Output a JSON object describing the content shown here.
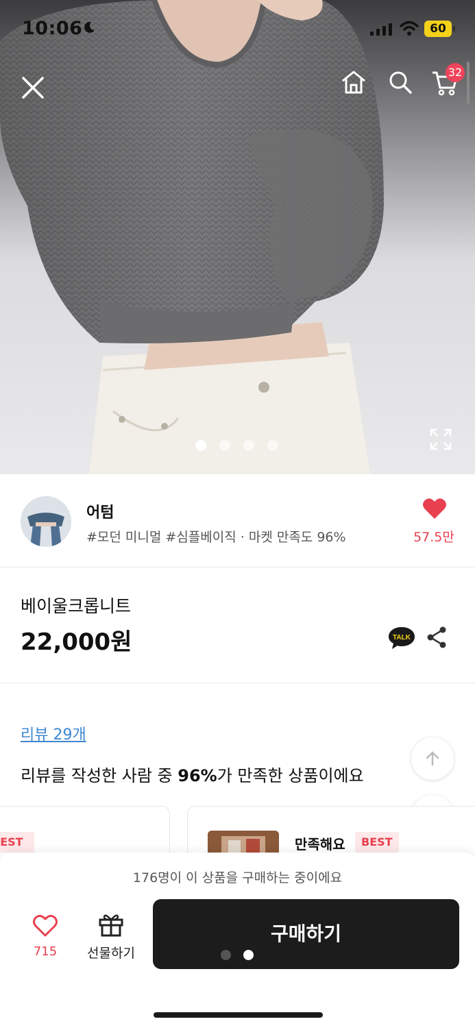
{
  "status_bar": {
    "time": "10:06",
    "battery": "60"
  },
  "header": {
    "cart_count": "32"
  },
  "gallery": {
    "image_count": 4,
    "active_index": 0
  },
  "shop": {
    "name": "어텀",
    "tags": "#모던 미니멀 #심플베이직 · 마켓 만족도 96%",
    "likes": "57.5만"
  },
  "product": {
    "name": "베이울크롭니트",
    "price": "22,000원",
    "talk_label": "TALK"
  },
  "reviews": {
    "link": "리뷰 29개",
    "summary_prefix": "리뷰를 작성한 사람 중 ",
    "summary_percent": "96%",
    "summary_suffix": "가 만족한 상품이에요",
    "cards": [
      {
        "badge": "BEST"
      },
      {
        "title": "만족해요",
        "badge": "BEST"
      }
    ]
  },
  "bottom_bar": {
    "buying_note": "176명이 이 상품을 구매하는 중이에요",
    "wish_count": "715",
    "gift_label": "선물하기",
    "buy_label": "구매하기"
  },
  "colors": {
    "accent": "#e8404f",
    "link": "#3f87d2",
    "buy_button": "#1c1c1c"
  },
  "icons": [
    "close-icon",
    "home-icon",
    "search-icon",
    "cart-icon",
    "expand-icon",
    "heart-icon",
    "talk-icon",
    "share-icon",
    "arrow-up-icon",
    "arrow-down-icon",
    "gift-icon"
  ]
}
